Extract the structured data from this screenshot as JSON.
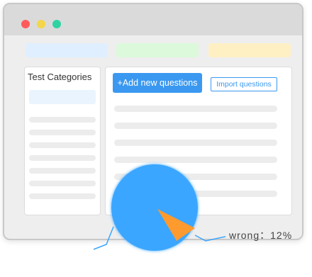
{
  "window": {
    "controls": [
      "close",
      "minimize",
      "maximize"
    ]
  },
  "sidebar": {
    "title": "Test Categories",
    "item_count": 7
  },
  "main": {
    "add_button_label": "+Add new questions",
    "import_button_label": "Import questions",
    "question_rows": 7
  },
  "colors": {
    "accent": "#3a98f0",
    "pie_main": "#3aa6ff",
    "pie_slice": "#ff9a2e",
    "chip_blue": "#dfefff",
    "chip_green": "#dcf9dc",
    "chip_yellow": "#fff0c4"
  },
  "pie": {
    "wrong_label": "wrong：12%",
    "wrong_fraction": 0.12
  }
}
